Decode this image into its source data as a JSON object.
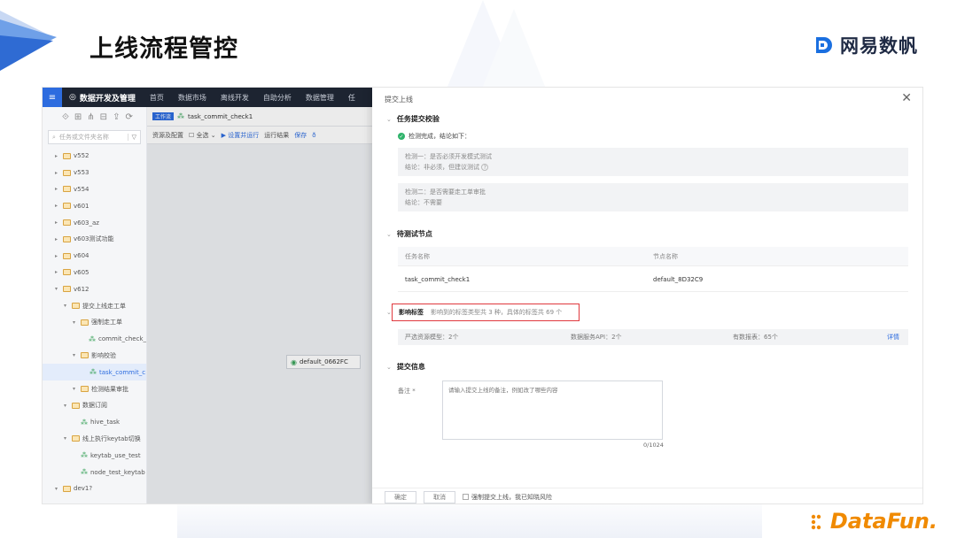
{
  "slide": {
    "title": "上线流程管控",
    "brand": "网易数帆",
    "datafun": "DataFun."
  },
  "topnav": {
    "menu_icon": "≡",
    "app_name": "数据开发及管理",
    "items": [
      "首页",
      "数据市场",
      "离线开发",
      "自助分析",
      "数据管理",
      "任"
    ]
  },
  "sidebar": {
    "search_placeholder": "任务或文件夹名称",
    "filter_icon": "▽",
    "tree": [
      {
        "label": "v552",
        "level": 0,
        "type": "folder",
        "expanded": false
      },
      {
        "label": "v553",
        "level": 0,
        "type": "folder",
        "expanded": false
      },
      {
        "label": "v554",
        "level": 0,
        "type": "folder",
        "expanded": false
      },
      {
        "label": "v601",
        "level": 0,
        "type": "folder",
        "expanded": false
      },
      {
        "label": "v603_az",
        "level": 0,
        "type": "folder",
        "expanded": false
      },
      {
        "label": "v603测试功能",
        "level": 0,
        "type": "folder",
        "expanded": false
      },
      {
        "label": "v604",
        "level": 0,
        "type": "folder",
        "expanded": false
      },
      {
        "label": "v605",
        "level": 0,
        "type": "folder",
        "expanded": false
      },
      {
        "label": "v612",
        "level": 0,
        "type": "folder",
        "expanded": true
      },
      {
        "label": "提交上线走工单",
        "level": 1,
        "type": "folder",
        "expanded": true
      },
      {
        "label": "强制走工单",
        "level": 2,
        "type": "folder",
        "expanded": true
      },
      {
        "label": "commit_check_",
        "level": 3,
        "type": "task"
      },
      {
        "label": "影响校验",
        "level": 2,
        "type": "folder",
        "expanded": true
      },
      {
        "label": "task_commit_c",
        "level": 3,
        "type": "task",
        "selected": true
      },
      {
        "label": "检测结果审批",
        "level": 2,
        "type": "folder",
        "expanded": true
      },
      {
        "label": "数据订阅",
        "level": 1,
        "type": "folder",
        "expanded": true
      },
      {
        "label": "hive_task",
        "level": 2,
        "type": "task"
      },
      {
        "label": "线上执行keytab切换",
        "level": 1,
        "type": "folder",
        "expanded": true
      },
      {
        "label": "keytab_use_test",
        "level": 2,
        "type": "task"
      },
      {
        "label": "node_test_keytab",
        "level": 2,
        "type": "task"
      },
      {
        "label": "dev1?",
        "level": 0,
        "type": "folder",
        "expanded": true
      }
    ]
  },
  "editor": {
    "tab_badge": "工作流",
    "tab_name": "task_commit_check1",
    "toolbar": [
      "资源及配置",
      "全选",
      "设置并运行",
      "运行结果",
      "保存",
      "ð"
    ],
    "flow_node": "default_0662FC"
  },
  "drawer": {
    "title": "提交上线",
    "close_icon": "✕",
    "section1": {
      "title": "任务提交校验",
      "status": "检测完成，结论如下：",
      "check1_item": "检测一：是否必须开发模式测试",
      "check1_result": "结论：非必须，但建议测试",
      "check2_item": "检测二：是否需要走工单审批",
      "check2_result": "结论：不需要"
    },
    "section2": {
      "title": "待测试节点",
      "col_task": "任务名称",
      "col_node": "节点名称",
      "row_task": "task_commit_check1",
      "row_node": "default_8D32C9"
    },
    "section3": {
      "title": "影响标签",
      "summary": "影响到的标签类型共 3 种，具体的标签共 69 个",
      "tag1": "严选资源模型：2个",
      "tag2": "数据服务API：2个",
      "tag3": "有数报表：65个",
      "detail": "详情"
    },
    "section4": {
      "title": "提交信息",
      "remark_label": "备注 *",
      "remark_placeholder": "请输入提交上线的备注，例如改了哪些内容",
      "count": "0/1024"
    },
    "footer": {
      "confirm": "确定",
      "cancel": "取消",
      "force": "强制提交上线，我已知晓风险"
    }
  },
  "colors": {
    "accent": "#2d6cdf",
    "highlight": "#e0393e",
    "success": "#2fb36b",
    "datafun": "#f08a00"
  }
}
